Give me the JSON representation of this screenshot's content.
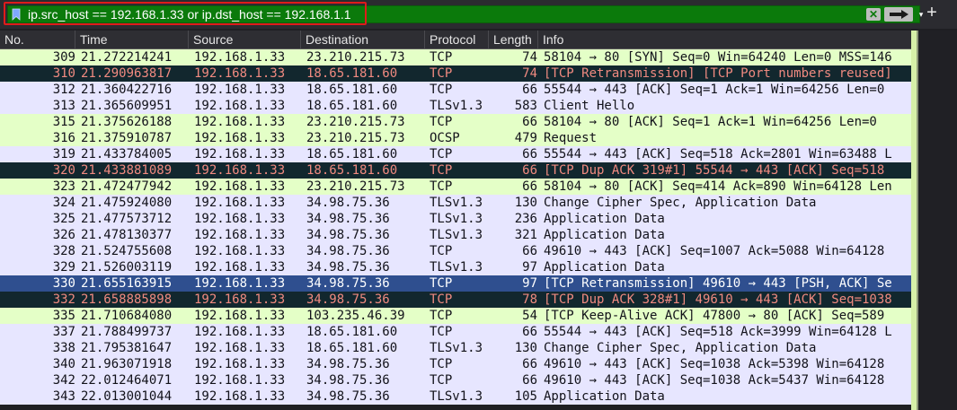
{
  "filter": {
    "expression": "ip.src_host == 192.168.1.33 or ip.dst_host == 192.168.1.1",
    "clear_symbol": "✕",
    "dropdown_symbol": "▾",
    "add_symbol": "+"
  },
  "columns": [
    "No.",
    "Time",
    "Source",
    "Destination",
    "Protocol",
    "Length",
    "Info"
  ],
  "row_colors": {
    "light_green": "#e4ffc7",
    "light_purple": "#e7e6ff",
    "dark": "#12272e",
    "selected": "#2f4f8f",
    "highlight_outline": "#e01b1b",
    "filter_valid": "#0b7a0b"
  },
  "packets": [
    {
      "no": "309",
      "time": "21.272214241",
      "src": "192.168.1.33",
      "dst": "23.210.215.73",
      "proto": "TCP",
      "len": "74",
      "info": "58104 → 80 [SYN] Seq=0 Win=64240 Len=0 MSS=146",
      "style": "light_green"
    },
    {
      "no": "310",
      "time": "21.290963817",
      "src": "192.168.1.33",
      "dst": "18.65.181.60",
      "proto": "TCP",
      "len": "74",
      "info": "[TCP Retransmission] [TCP Port numbers reused]",
      "style": "dark"
    },
    {
      "no": "312",
      "time": "21.360422716",
      "src": "192.168.1.33",
      "dst": "18.65.181.60",
      "proto": "TCP",
      "len": "66",
      "info": "55544 → 443 [ACK] Seq=1 Ack=1 Win=64256 Len=0",
      "style": "light_purple"
    },
    {
      "no": "313",
      "time": "21.365609951",
      "src": "192.168.1.33",
      "dst": "18.65.181.60",
      "proto": "TLSv1.3",
      "len": "583",
      "info": "Client Hello",
      "style": "light_purple"
    },
    {
      "no": "315",
      "time": "21.375626188",
      "src": "192.168.1.33",
      "dst": "23.210.215.73",
      "proto": "TCP",
      "len": "66",
      "info": "58104 → 80 [ACK] Seq=1 Ack=1 Win=64256 Len=0",
      "style": "light_green"
    },
    {
      "no": "316",
      "time": "21.375910787",
      "src": "192.168.1.33",
      "dst": "23.210.215.73",
      "proto": "OCSP",
      "len": "479",
      "info": "Request",
      "style": "light_green"
    },
    {
      "no": "319",
      "time": "21.433784005",
      "src": "192.168.1.33",
      "dst": "18.65.181.60",
      "proto": "TCP",
      "len": "66",
      "info": "55544 → 443 [ACK] Seq=518 Ack=2801 Win=63488 L",
      "style": "light_purple"
    },
    {
      "no": "320",
      "time": "21.433881089",
      "src": "192.168.1.33",
      "dst": "18.65.181.60",
      "proto": "TCP",
      "len": "66",
      "info": "[TCP Dup ACK 319#1] 55544 → 443 [ACK] Seq=518",
      "style": "dark"
    },
    {
      "no": "323",
      "time": "21.472477942",
      "src": "192.168.1.33",
      "dst": "23.210.215.73",
      "proto": "TCP",
      "len": "66",
      "info": "58104 → 80 [ACK] Seq=414 Ack=890 Win=64128 Len",
      "style": "light_green"
    },
    {
      "no": "324",
      "time": "21.475924080",
      "src": "192.168.1.33",
      "dst": "34.98.75.36",
      "proto": "TLSv1.3",
      "len": "130",
      "info": "Change Cipher Spec, Application Data",
      "style": "light_purple"
    },
    {
      "no": "325",
      "time": "21.477573712",
      "src": "192.168.1.33",
      "dst": "34.98.75.36",
      "proto": "TLSv1.3",
      "len": "236",
      "info": "Application Data",
      "style": "light_purple"
    },
    {
      "no": "326",
      "time": "21.478130377",
      "src": "192.168.1.33",
      "dst": "34.98.75.36",
      "proto": "TLSv1.3",
      "len": "321",
      "info": "Application Data",
      "style": "light_purple"
    },
    {
      "no": "328",
      "time": "21.524755608",
      "src": "192.168.1.33",
      "dst": "34.98.75.36",
      "proto": "TCP",
      "len": "66",
      "info": "49610 → 443 [ACK] Seq=1007 Ack=5088 Win=64128",
      "style": "light_purple"
    },
    {
      "no": "329",
      "time": "21.526003119",
      "src": "192.168.1.33",
      "dst": "34.98.75.36",
      "proto": "TLSv1.3",
      "len": "97",
      "info": "Application Data",
      "style": "light_purple"
    },
    {
      "no": "330",
      "time": "21.655163915",
      "src": "192.168.1.33",
      "dst": "34.98.75.36",
      "proto": "TCP",
      "len": "97",
      "info": "[TCP Retransmission] 49610 → 443 [PSH, ACK] Se",
      "style": "selected"
    },
    {
      "no": "332",
      "time": "21.658885898",
      "src": "192.168.1.33",
      "dst": "34.98.75.36",
      "proto": "TCP",
      "len": "78",
      "info": "[TCP Dup ACK 328#1] 49610 → 443 [ACK] Seq=1038",
      "style": "dark"
    },
    {
      "no": "335",
      "time": "21.710684080",
      "src": "192.168.1.33",
      "dst": "103.235.46.39",
      "proto": "TCP",
      "len": "54",
      "info": "[TCP Keep-Alive ACK] 47800 → 80 [ACK] Seq=589",
      "style": "light_green"
    },
    {
      "no": "337",
      "time": "21.788499737",
      "src": "192.168.1.33",
      "dst": "18.65.181.60",
      "proto": "TCP",
      "len": "66",
      "info": "55544 → 443 [ACK] Seq=518 Ack=3999 Win=64128 L",
      "style": "light_purple"
    },
    {
      "no": "338",
      "time": "21.795381647",
      "src": "192.168.1.33",
      "dst": "18.65.181.60",
      "proto": "TLSv1.3",
      "len": "130",
      "info": "Change Cipher Spec, Application Data",
      "style": "light_purple"
    },
    {
      "no": "340",
      "time": "21.963071918",
      "src": "192.168.1.33",
      "dst": "34.98.75.36",
      "proto": "TCP",
      "len": "66",
      "info": "49610 → 443 [ACK] Seq=1038 Ack=5398 Win=64128",
      "style": "light_purple"
    },
    {
      "no": "342",
      "time": "22.012464071",
      "src": "192.168.1.33",
      "dst": "34.98.75.36",
      "proto": "TCP",
      "len": "66",
      "info": "49610 → 443 [ACK] Seq=1038 Ack=5437 Win=64128",
      "style": "light_purple"
    },
    {
      "no": "343",
      "time": "22.013001044",
      "src": "192.168.1.33",
      "dst": "34.98.75.36",
      "proto": "TLSv1.3",
      "len": "105",
      "info": "Application Data",
      "style": "light_purple"
    }
  ]
}
